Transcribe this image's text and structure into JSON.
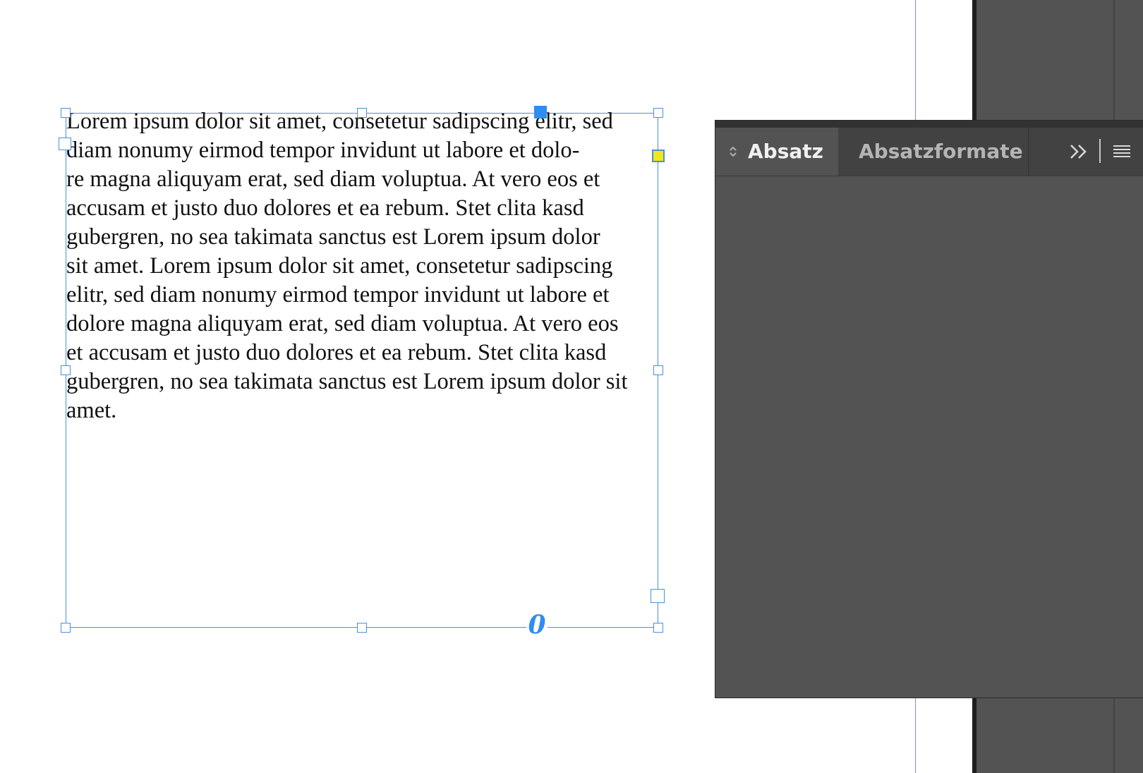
{
  "document": {
    "paragraph_lines": [
      "Lorem ipsum dolor sit amet, consetetur sadipscing elitr, sed",
      "diam nonumy eirmod tempor invidunt ut labore et dolo-",
      "re magna aliquyam erat, sed diam voluptua. At vero eos et",
      "accusam et justo duo dolores et ea rebum. Stet clita kasd",
      "gubergren, no sea takimata sanctus est Lorem ipsum dolor",
      "sit amet. Lorem ipsum dolor sit amet, consetetur sadipscing",
      "elitr, sed diam nonumy eirmod tempor invidunt ut labore et",
      "dolore magna aliquyam erat, sed diam voluptua. At vero eos",
      "et accusam et justo duo dolores et ea rebum. Stet clita kasd",
      "gubergren, no sea takimata sanctus est Lorem ipsum dolor sit",
      "amet."
    ],
    "out_port_symbol": "0"
  },
  "panel": {
    "tabs": [
      {
        "label": "Absatz",
        "active": true
      },
      {
        "label": "Absatzformate",
        "active": false
      }
    ],
    "icons": {
      "tab_sort": "sort-arrows-icon",
      "expand": "double-chevron-right-icon",
      "menu": "panel-menu-icon"
    }
  },
  "colors": {
    "frame_selection": "#4a90d9",
    "anchor_handle": "#2f8cf2",
    "in_port": "#f5e617",
    "panel_bg": "#535353",
    "tab_bar_bg": "#424242",
    "page_guide": "#9b7fc9"
  }
}
